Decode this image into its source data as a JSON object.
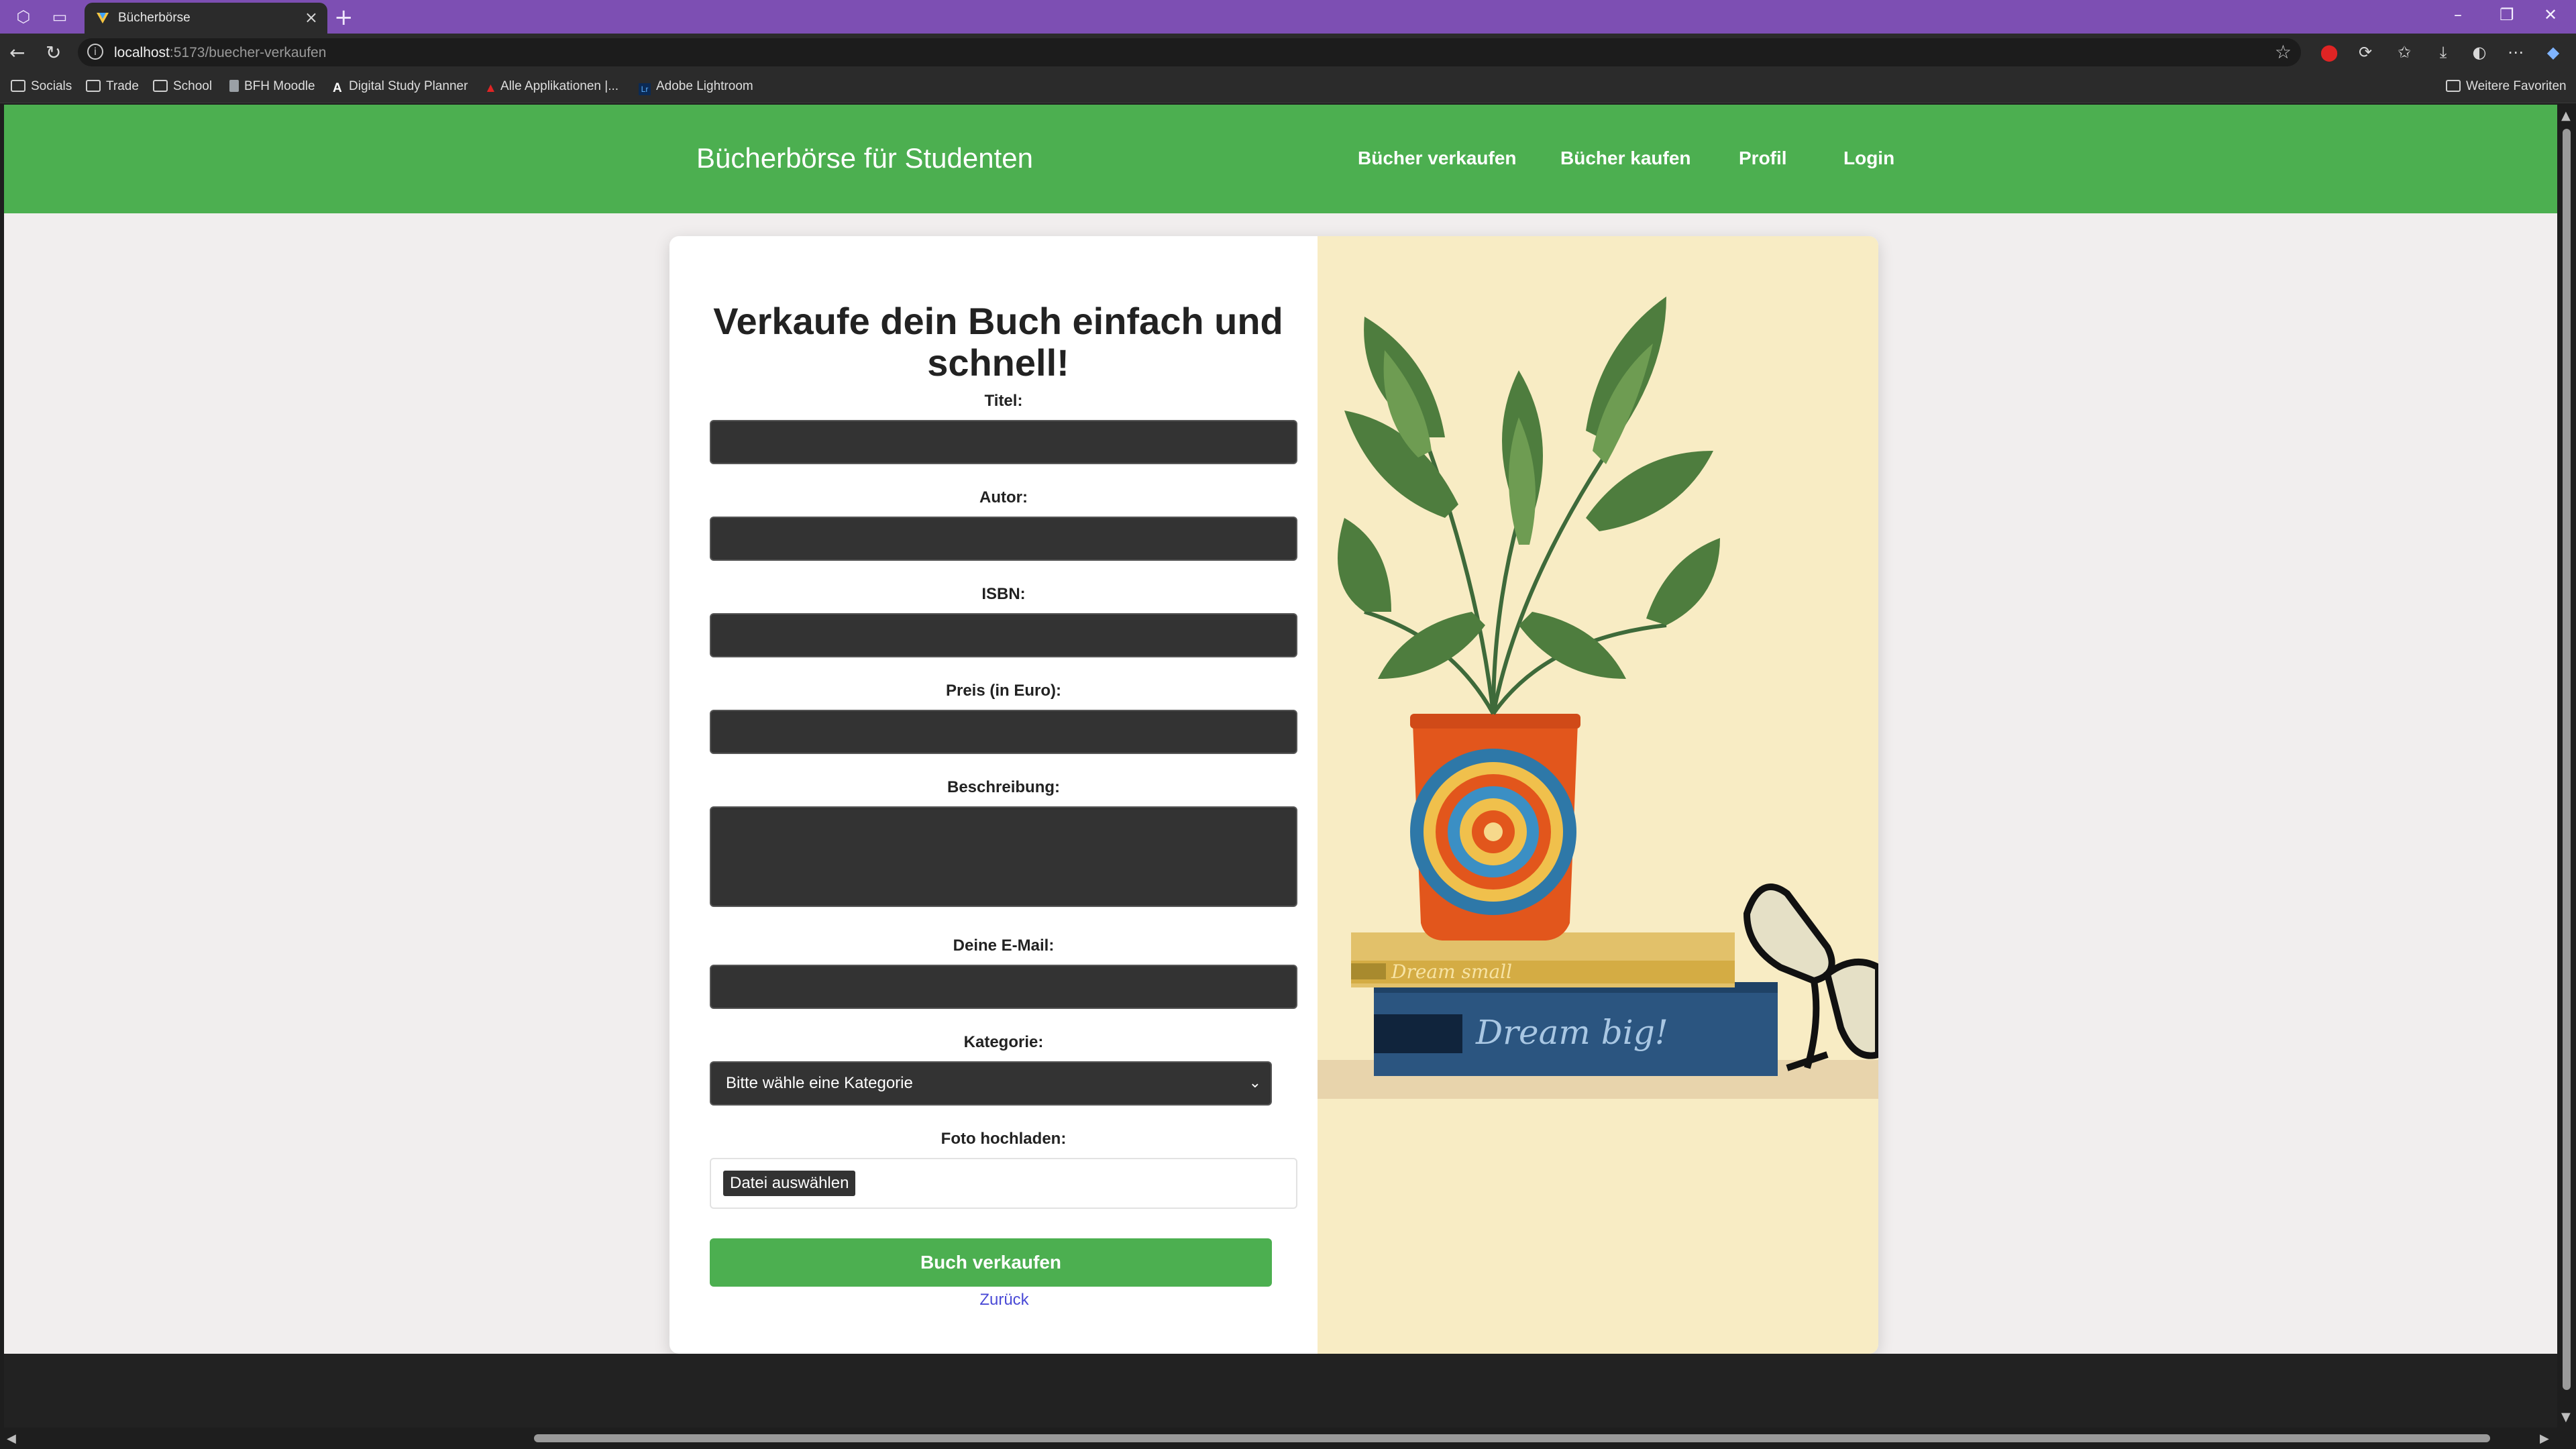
{
  "browser": {
    "tab_title": "Bücherbörse",
    "url_host": "localhost",
    "url_path": ":5173/buecher-verkaufen",
    "bookmarks": [
      "Socials",
      "Trade",
      "School",
      "BFH Moodle",
      "Digital Study Planner",
      "Alle Applikationen |...",
      "Adobe Lightroom"
    ],
    "other_favorites": "Weitere Favoriten"
  },
  "site": {
    "brand": "Bücherbörse für Studenten",
    "nav": [
      "Bücher verkaufen",
      "Bücher kaufen",
      "Profil",
      "Login"
    ]
  },
  "form": {
    "title": "Verkaufe dein Buch einfach und schnell!",
    "fields": {
      "title_label": "Titel:",
      "author_label": "Autor:",
      "isbn_label": "ISBN:",
      "price_label": "Preis (in Euro):",
      "description_label": "Beschreibung:",
      "email_label": "Deine E-Mail:",
      "category_label": "Kategorie:",
      "category_value": "Bitte wähle eine Kategorie",
      "photo_label": "Foto hochladen:",
      "file_button": "Datei auswählen"
    },
    "submit": "Buch verkaufen",
    "back": "Zurück"
  },
  "illustration": {
    "book_small": "Dream small",
    "book_big": "Dream big!"
  },
  "colors": {
    "accent": "#4caf50",
    "tabbar": "#7d4fb3",
    "field_bg": "#333333",
    "illustration_bg": "#f8ecc4"
  }
}
